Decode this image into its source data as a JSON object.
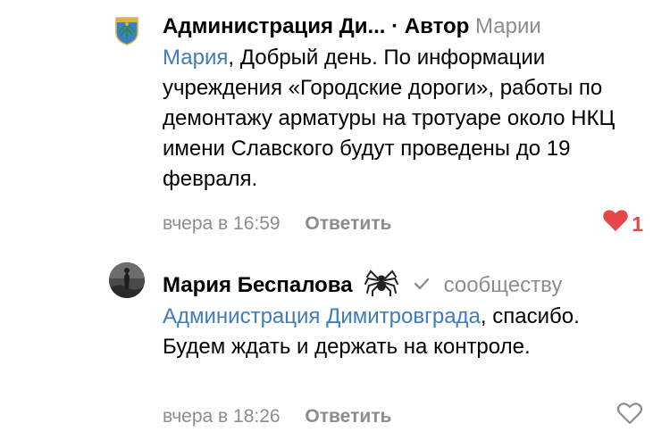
{
  "comments": [
    {
      "author": "Администрация  Ди...",
      "author_tag": "· Автор",
      "to_prefix": "Марии",
      "reply_to_name": "Мария",
      "text": ", Добрый день. По информации учреждения «Городские дороги», работы по демонтажу арматуры на тротуаре около НКЦ имени Славского будут проведены до 19 февраля.",
      "time": "вчера в 16:59",
      "reply_label": "Ответить",
      "like_count": "1",
      "liked": true
    },
    {
      "author": "Мария Беспалова",
      "to_prefix": "сообществу",
      "reply_to_name": "Администрация  Димитровграда",
      "text": ", спасибо. Будем ждать и держать на контроле.",
      "time": "вчера в 18:26",
      "reply_label": "Ответить",
      "liked": false
    }
  ],
  "colors": {
    "link": "#3f7bc0",
    "muted": "#8c8c91",
    "like": "#e64646"
  },
  "icons": {
    "first_avatar": "coat-of-arms-icon",
    "author_badge": "spider-icon",
    "answered": "checkmark-icon",
    "like_filled": "heart-filled-icon",
    "like_empty": "heart-outline-icon"
  }
}
